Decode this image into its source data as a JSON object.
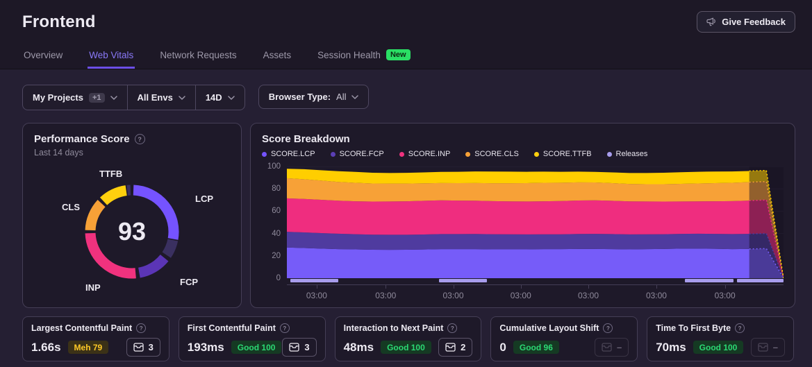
{
  "header": {
    "title": "Frontend",
    "feedback_label": "Give Feedback",
    "tabs": [
      {
        "label": "Overview"
      },
      {
        "label": "Web Vitals"
      },
      {
        "label": "Network Requests"
      },
      {
        "label": "Assets"
      },
      {
        "label": "Session Health",
        "badge": "New"
      }
    ]
  },
  "filters": {
    "projects_label": "My Projects",
    "projects_extra": "+1",
    "envs_label": "All Envs",
    "date_range_label": "14D",
    "browser_type_label": "Browser Type:",
    "browser_type_value": "All"
  },
  "performance_panel": {
    "title": "Performance Score",
    "subtitle": "Last 14 days"
  },
  "breakdown_panel": {
    "title": "Score Breakdown",
    "legend": [
      {
        "label": "SCORE.LCP",
        "color": "#7553FF"
      },
      {
        "label": "SCORE.FCP",
        "color": "#5B3FB5"
      },
      {
        "label": "SCORE.INP",
        "color": "#F0327E"
      },
      {
        "label": "SCORE.CLS",
        "color": "#F7A137"
      },
      {
        "label": "SCORE.TTFB",
        "color": "#FFD00E"
      },
      {
        "label": "Releases",
        "color": "#A89DED"
      }
    ]
  },
  "cards": [
    {
      "title": "Largest Contentful Paint",
      "value": "1.66s",
      "badge": "Meh 79",
      "tone": "meh",
      "issues": "3",
      "issues_enabled": true
    },
    {
      "title": "First Contentful Paint",
      "value": "193ms",
      "badge": "Good 100",
      "tone": "good",
      "issues": "3",
      "issues_enabled": true
    },
    {
      "title": "Interaction to Next Paint",
      "value": "48ms",
      "badge": "Good 100",
      "tone": "good",
      "issues": "2",
      "issues_enabled": true
    },
    {
      "title": "Cumulative Layout Shift",
      "value": "0",
      "badge": "Good 96",
      "tone": "good",
      "issues": "–",
      "issues_enabled": false
    },
    {
      "title": "Time To First Byte",
      "value": "70ms",
      "badge": "Good 100",
      "tone": "good",
      "issues": "–",
      "issues_enabled": false
    }
  ],
  "chart_data": [
    {
      "id": "performance-score-ring",
      "type": "donut",
      "title": "Performance Score",
      "subtitle": "Last 14 days",
      "score": "93",
      "dim_color": "#3A3060",
      "segments": [
        {
          "name": "LCP",
          "color": "#7553FF",
          "start": 2,
          "bright_end": 100,
          "end": 124
        },
        {
          "name": "FCP",
          "color": "#5B35B6",
          "start": 129,
          "bright_end": 170,
          "end": 170
        },
        {
          "name": "INP",
          "color": "#F0327E",
          "start": 175,
          "bright_end": 268,
          "end": 268
        },
        {
          "name": "CLS",
          "color": "#F7A137",
          "start": 272,
          "bright_end": 313,
          "end": 313
        },
        {
          "name": "TTFB",
          "color": "#FFD00E",
          "start": 317,
          "bright_end": 352,
          "end": 358
        }
      ]
    },
    {
      "id": "score-breakdown",
      "type": "area",
      "stacked": true,
      "title": "Score Breakdown",
      "ylim": [
        0,
        100
      ],
      "yticks": [
        0,
        20,
        40,
        60,
        80,
        100
      ],
      "grid_color": "#2B2439",
      "xticks": {
        "label": "03:00",
        "fractions": [
          0.06,
          0.199,
          0.335,
          0.471,
          0.607,
          0.744,
          0.882
        ]
      },
      "incomplete_from_fraction": 0.931,
      "series": [
        {
          "name": "SCORE.LCP",
          "color": "#765CF9",
          "values": [
            27.5,
            27,
            26.5,
            26,
            25.8,
            25.5,
            25.4,
            25.5,
            25.7,
            26,
            26,
            26,
            25.8,
            25.8,
            25.8,
            26,
            26,
            26.2,
            26.2,
            26,
            25.8,
            26,
            26.2,
            26.5,
            26.5,
            26.3,
            26,
            26.2,
            26.5,
            0
          ]
        },
        {
          "name": "SCORE.FCP",
          "color": "#4F3B9F",
          "values": [
            14,
            14,
            13.9,
            13.8,
            13.6,
            13.5,
            13.5,
            13.4,
            13.4,
            13.5,
            13.5,
            13.6,
            13.6,
            13.5,
            13.4,
            13.3,
            13.3,
            13.4,
            13.5,
            13.5,
            13.4,
            13.3,
            13.2,
            13.2,
            13.3,
            13.4,
            13.5,
            13.5,
            13.5,
            0
          ]
        },
        {
          "name": "SCORE.INP",
          "color": "#EF2D7F",
          "values": [
            30,
            30,
            29.8,
            29.6,
            29.5,
            29.6,
            29.8,
            30,
            30.2,
            30.2,
            30,
            29.8,
            29.6,
            29.5,
            29.5,
            29.6,
            29.8,
            30,
            30,
            29.8,
            29.6,
            29.4,
            29.2,
            29,
            29,
            29.2,
            29.5,
            29.8,
            30,
            0
          ]
        },
        {
          "name": "SCORE.CLS",
          "color": "#F7A137",
          "values": [
            18,
            17.6,
            17.2,
            16.8,
            16.5,
            16.2,
            16,
            15.8,
            15.6,
            15.5,
            15.6,
            15.8,
            16,
            16.2,
            16.4,
            16.5,
            16.4,
            16.2,
            16,
            15.8,
            15.6,
            15.5,
            15.6,
            15.8,
            16,
            16.2,
            16.4,
            16.5,
            16.5,
            0
          ]
        },
        {
          "name": "SCORE.TTFB",
          "color": "#FFCE00",
          "values": [
            8.5,
            9,
            9.3,
            9.6,
            9.8,
            9.6,
            9.5,
            9.6,
            9.8,
            10,
            10.2,
            10.4,
            10.5,
            10.4,
            10.2,
            10,
            9.8,
            9.6,
            9.5,
            9.6,
            9.8,
            10,
            10.2,
            10.4,
            10.5,
            10.4,
            10.2,
            10,
            10,
            0
          ]
        }
      ],
      "releases": {
        "color": "#A89DED",
        "bars": [
          [
            0.007,
            0.104
          ],
          [
            0.306,
            0.403
          ],
          [
            0.801,
            0.899
          ],
          [
            0.906,
            1.0
          ]
        ]
      }
    }
  ]
}
